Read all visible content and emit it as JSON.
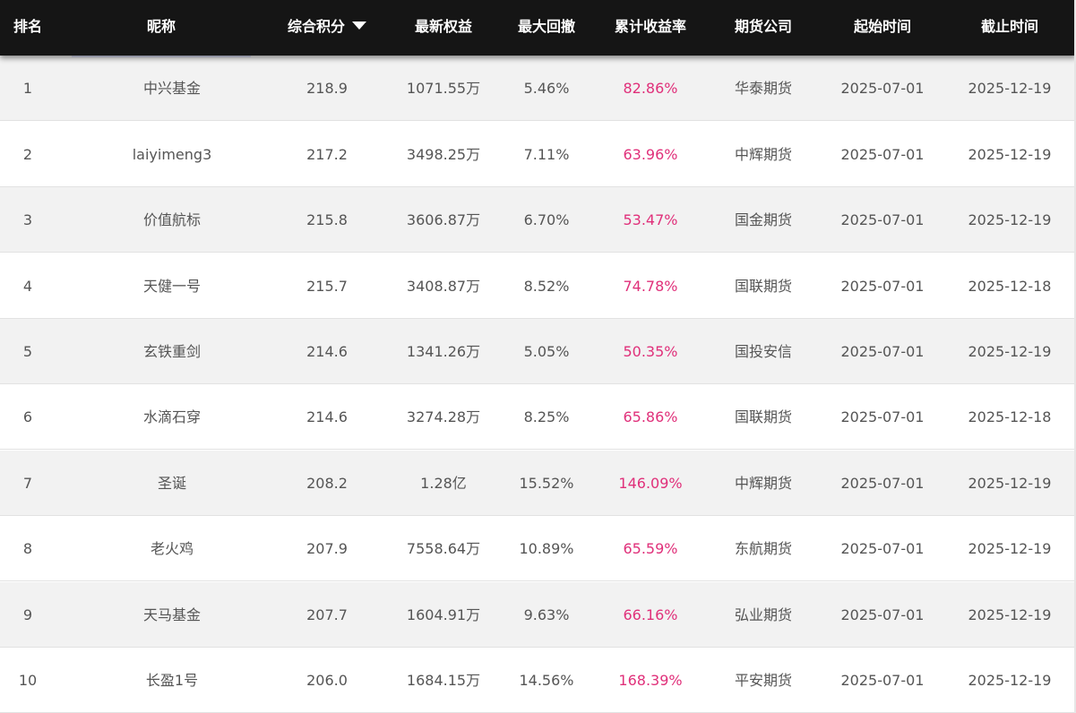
{
  "columns": {
    "rank": "排名",
    "nickname": "昵称",
    "score": "综合积分",
    "equity": "最新权益",
    "drawdown": "最大回撤",
    "return_rate": "累计收益率",
    "company": "期货公司",
    "start": "起始时间",
    "end": "截止时间"
  },
  "sort": {
    "column": "score",
    "direction": "desc",
    "icon": "caret-down-icon"
  },
  "colors": {
    "header_bg": "#151515",
    "row_alt": "#f2f2f2",
    "rate": "#e0307a"
  },
  "rows": [
    {
      "rank": "1",
      "nickname": "中兴基金",
      "score": "218.9",
      "equity": "1071.55万",
      "drawdown": "5.46%",
      "return_rate": "82.86%",
      "company": "华泰期货",
      "start": "2025-07-01",
      "end": "2025-12-19"
    },
    {
      "rank": "2",
      "nickname": "laiyimeng3",
      "score": "217.2",
      "equity": "3498.25万",
      "drawdown": "7.11%",
      "return_rate": "63.96%",
      "company": "中辉期货",
      "start": "2025-07-01",
      "end": "2025-12-19"
    },
    {
      "rank": "3",
      "nickname": "价值航标",
      "score": "215.8",
      "equity": "3606.87万",
      "drawdown": "6.70%",
      "return_rate": "53.47%",
      "company": "国金期货",
      "start": "2025-07-01",
      "end": "2025-12-19"
    },
    {
      "rank": "4",
      "nickname": "天健一号",
      "score": "215.7",
      "equity": "3408.87万",
      "drawdown": "8.52%",
      "return_rate": "74.78%",
      "company": "国联期货",
      "start": "2025-07-01",
      "end": "2025-12-18"
    },
    {
      "rank": "5",
      "nickname": "玄铁重剑",
      "score": "214.6",
      "equity": "1341.26万",
      "drawdown": "5.05%",
      "return_rate": "50.35%",
      "company": "国投安信",
      "start": "2025-07-01",
      "end": "2025-12-19"
    },
    {
      "rank": "6",
      "nickname": "水滴石穿",
      "score": "214.6",
      "equity": "3274.28万",
      "drawdown": "8.25%",
      "return_rate": "65.86%",
      "company": "国联期货",
      "start": "2025-07-01",
      "end": "2025-12-18"
    },
    {
      "rank": "7",
      "nickname": "圣诞",
      "score": "208.2",
      "equity": "1.28亿",
      "drawdown": "15.52%",
      "return_rate": "146.09%",
      "company": "中辉期货",
      "start": "2025-07-01",
      "end": "2025-12-19"
    },
    {
      "rank": "8",
      "nickname": "老火鸡",
      "score": "207.9",
      "equity": "7558.64万",
      "drawdown": "10.89%",
      "return_rate": "65.59%",
      "company": "东航期货",
      "start": "2025-07-01",
      "end": "2025-12-19"
    },
    {
      "rank": "9",
      "nickname": "天马基金",
      "score": "207.7",
      "equity": "1604.91万",
      "drawdown": "9.63%",
      "return_rate": "66.16%",
      "company": "弘业期货",
      "start": "2025-07-01",
      "end": "2025-12-19"
    },
    {
      "rank": "10",
      "nickname": "长盈1号",
      "score": "206.0",
      "equity": "1684.15万",
      "drawdown": "14.56%",
      "return_rate": "168.39%",
      "company": "平安期货",
      "start": "2025-07-01",
      "end": "2025-12-19"
    }
  ]
}
